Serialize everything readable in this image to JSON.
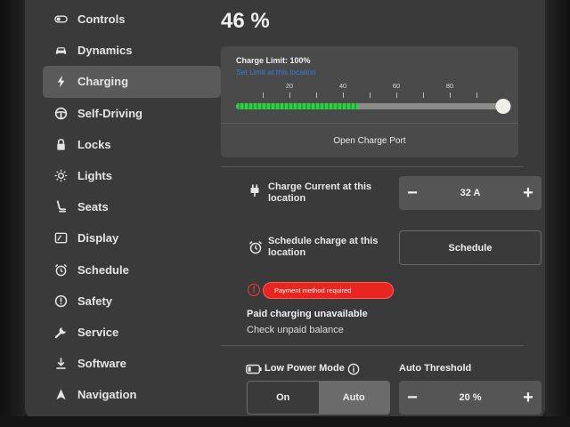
{
  "sidebar": {
    "items": [
      {
        "label": "Controls",
        "icon": "toggle-icon"
      },
      {
        "label": "Dynamics",
        "icon": "car-icon"
      },
      {
        "label": "Charging",
        "icon": "bolt-icon",
        "active": true
      },
      {
        "label": "Self-Driving",
        "icon": "steering-wheel-icon"
      },
      {
        "label": "Locks",
        "icon": "lock-icon"
      },
      {
        "label": "Lights",
        "icon": "sun-icon"
      },
      {
        "label": "Seats",
        "icon": "seat-icon"
      },
      {
        "label": "Display",
        "icon": "display-icon"
      },
      {
        "label": "Schedule",
        "icon": "alarm-clock-icon"
      },
      {
        "label": "Safety",
        "icon": "info-circle-icon"
      },
      {
        "label": "Service",
        "icon": "wrench-icon"
      },
      {
        "label": "Software",
        "icon": "download-icon"
      },
      {
        "label": "Navigation",
        "icon": "navigation-arrow-icon"
      }
    ]
  },
  "battery": {
    "percent_text": "46 %"
  },
  "charge_limit": {
    "title": "Charge Limit: 100%",
    "link": "Set Limit at this location",
    "tick_labels": [
      "20",
      "40",
      "60",
      "80"
    ],
    "limit_fraction": 1.0,
    "current_fraction": 0.46,
    "open_port_label": "Open Charge Port"
  },
  "charge_current": {
    "label": "Charge Current at this location",
    "value": "32 A",
    "minus": "−",
    "plus": "+"
  },
  "schedule_charge": {
    "label": "Schedule charge at this location",
    "button": "Schedule"
  },
  "payment": {
    "warning_icon": "!",
    "badge": "Payment method required",
    "title": "Paid charging unavailable",
    "subtitle": "Check unpaid balance"
  },
  "low_power": {
    "label": "Low Power Mode",
    "options": [
      "On",
      "Auto"
    ],
    "selected": "Auto"
  },
  "auto_threshold": {
    "label": "Auto Threshold",
    "value": "20 %",
    "minus": "−",
    "plus": "+"
  },
  "colors": {
    "accent_green": "#2fbf45",
    "warning_red": "#e8261f",
    "link_blue": "#3a7bd5"
  }
}
